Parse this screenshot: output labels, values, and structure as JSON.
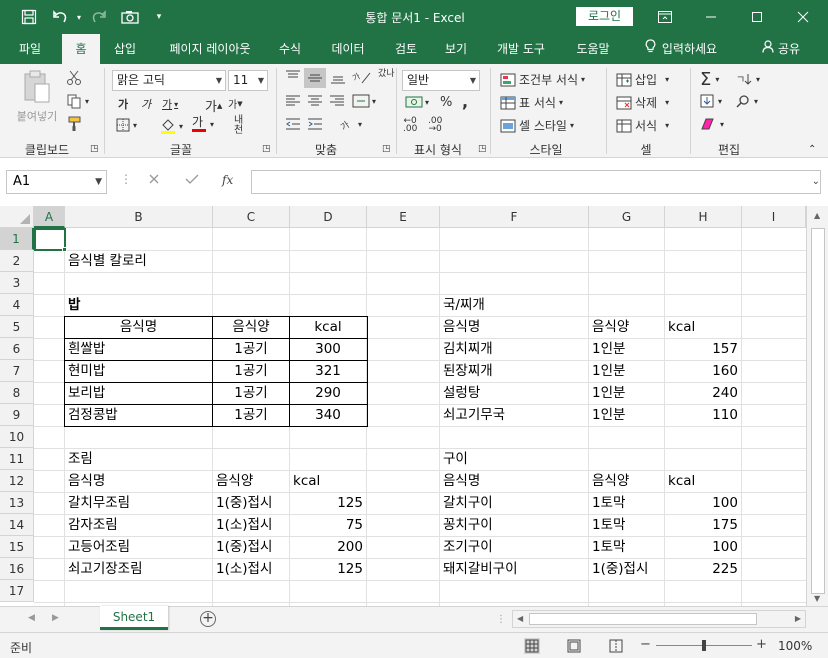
{
  "window": {
    "title": "통합 문서1  -  Excel",
    "login_label": "로그인",
    "quick_access": [
      "save-icon",
      "undo-icon",
      "redo-icon",
      "camera-icon",
      "customize-icon"
    ]
  },
  "tabs": [
    {
      "label": "파일"
    },
    {
      "label": "홈"
    },
    {
      "label": "삽입"
    },
    {
      "label": "페이지 레이아웃"
    },
    {
      "label": "수식"
    },
    {
      "label": "데이터"
    },
    {
      "label": "검토"
    },
    {
      "label": "보기"
    },
    {
      "label": "개발 도구"
    },
    {
      "label": "도움말"
    },
    {
      "label": "입력하세요"
    },
    {
      "label": "공유"
    }
  ],
  "ribbon": {
    "paste_label": "붙여넣기",
    "font_name": "맑은 고딕",
    "font_size": "11",
    "number_format": "일반",
    "conditional_format": "조건부 서식",
    "table_format": "표 서식",
    "cell_style": "셀 스타일",
    "insert": "삽입",
    "delete": "삭제",
    "format": "서식",
    "wrap": "갔나",
    "groups": [
      "클립보드",
      "글꼴",
      "맞춤",
      "표시 형식",
      "스타일",
      "셀",
      "편집"
    ]
  },
  "formula_bar": {
    "name_box": "A1",
    "fx": "fx",
    "value": ""
  },
  "columns": [
    "A",
    "B",
    "C",
    "D",
    "E",
    "F",
    "G",
    "H",
    "I"
  ],
  "rows": [
    "1",
    "2",
    "3",
    "4",
    "5",
    "6",
    "7",
    "8",
    "9",
    "10",
    "11",
    "12",
    "13",
    "14",
    "15",
    "16",
    "17"
  ],
  "sheet": {
    "title": "음식별 칼로리",
    "rice": {
      "heading": "밥",
      "headers": [
        "음식명",
        "음식양",
        "kcal"
      ],
      "rows": [
        [
          "흰쌀밥",
          "1공기",
          "300"
        ],
        [
          "현미밥",
          "1공기",
          "321"
        ],
        [
          "보리밥",
          "1공기",
          "290"
        ],
        [
          "검정콩밥",
          "1공기",
          "340"
        ]
      ]
    },
    "soup": {
      "heading": "국/찌개",
      "headers": [
        "음식명",
        "음식양",
        "kcal"
      ],
      "rows": [
        [
          "김치찌개",
          "1인분",
          "157"
        ],
        [
          "된장찌개",
          "1인분",
          "160"
        ],
        [
          "설렁탕",
          "1인분",
          "240"
        ],
        [
          "쇠고기무국",
          "1인분",
          "110"
        ]
      ]
    },
    "braised": {
      "heading": "조림",
      "headers": [
        "음식명",
        "음식양",
        "kcal"
      ],
      "rows": [
        [
          "갈치무조림",
          "1(중)접시",
          "125"
        ],
        [
          "감자조림",
          "1(소)접시",
          "75"
        ],
        [
          "고등어조림",
          "1(중)접시",
          "200"
        ],
        [
          "쇠고기장조림",
          "1(소)접시",
          "125"
        ]
      ]
    },
    "grilled": {
      "heading": "구이",
      "headers": [
        "음식명",
        "음식양",
        "kcal"
      ],
      "rows": [
        [
          "갈치구이",
          "1토막",
          "100"
        ],
        [
          "꽁치구이",
          "1토막",
          "175"
        ],
        [
          "조기구이",
          "1토막",
          "100"
        ],
        [
          "돼지갈비구이",
          "1(중)접시",
          "225"
        ]
      ]
    }
  },
  "sheet_tab": "Sheet1",
  "status": {
    "ready": "준비",
    "zoom": "100%"
  },
  "colors": {
    "brand": "#217346"
  }
}
